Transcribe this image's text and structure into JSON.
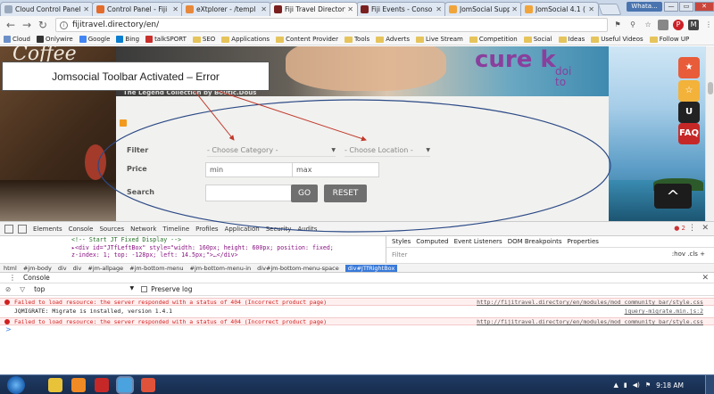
{
  "browser": {
    "tabs": [
      {
        "title": "Cloud Control Panel",
        "color": "#9aa8bb"
      },
      {
        "title": "Control Panel - Fiji",
        "color": "#e36b2c"
      },
      {
        "title": "eXtplorer - /templ",
        "color": "#e8883a"
      },
      {
        "title": "Fiji Travel Directory",
        "color": "#7a1f1f"
      },
      {
        "title": "Fiji Events - Conso",
        "color": "#7a1f1f"
      },
      {
        "title": "JomSocial Support",
        "color": "#f1a43a"
      },
      {
        "title": "JomSocial 4.1 (1/1",
        "color": "#f1a43a"
      }
    ],
    "user_badge": "Whata...",
    "window_buttons": {
      "minimize": "—",
      "maximize": "▭",
      "close": "✕"
    },
    "address": "fijitravel.directory/en/",
    "bookmarks": [
      {
        "label": "Cloud",
        "type": "site",
        "color": "#6b8fc9"
      },
      {
        "label": "Onlywire",
        "type": "site",
        "color": "#333333"
      },
      {
        "label": "Google",
        "type": "site",
        "color": "#4285f4"
      },
      {
        "label": "Bing",
        "type": "site",
        "color": "#0b7ecf"
      },
      {
        "label": "talkSPORT",
        "type": "site",
        "color": "#c9302c"
      },
      {
        "label": "SEO",
        "type": "folder"
      },
      {
        "label": "Applications",
        "type": "folder"
      },
      {
        "label": "Content Provider",
        "type": "folder"
      },
      {
        "label": "Tools",
        "type": "folder"
      },
      {
        "label": "Adverts",
        "type": "folder"
      },
      {
        "label": "Live Stream",
        "type": "folder"
      },
      {
        "label": "Competition",
        "type": "folder"
      },
      {
        "label": "Social",
        "type": "folder"
      },
      {
        "label": "Ideas",
        "type": "folder"
      },
      {
        "label": "Useful Videos",
        "type": "folder"
      },
      {
        "label": "Follow UP",
        "type": "folder"
      }
    ]
  },
  "page": {
    "left_decor_text": "Coffee",
    "brand_text": "cure k",
    "brand_sub": "doi",
    "brand_sub2": "to",
    "tagline": "The Legend Collection by Boutic.Dous",
    "filter": {
      "filter_label": "Filter",
      "category_placeholder": "- Choose Category -",
      "location_placeholder": "- Choose Location -",
      "price_label": "Price",
      "min_placeholder": "min",
      "max_placeholder": "max",
      "search_label": "Search",
      "go_button": "GO",
      "reset_button": "RESET"
    },
    "side_icons": [
      {
        "name": "ribbon-icon",
        "label": "★",
        "color": "#e85c3a"
      },
      {
        "name": "rating-icon",
        "label": "☆",
        "color": "#f3b23a"
      },
      {
        "name": "magnet-icon",
        "label": "U",
        "color": "#222222"
      },
      {
        "name": "faq-icon",
        "label": "FAQ",
        "color": "#c62828"
      }
    ],
    "up_arrow": "^"
  },
  "annotation": {
    "callout": "Jomsocial Toolbar Activated – Error",
    "arrow_color": "#c0392b",
    "ellipse_color": "#2c4a86"
  },
  "devtools": {
    "tabs": [
      "Elements",
      "Console",
      "Sources",
      "Network",
      "Timeline",
      "Profiles",
      "Application",
      "Security",
      "Audits"
    ],
    "error_count": "2",
    "elements_lines": [
      "<!-- Start JT Fixed Display -->",
      "▸<div id=\"JTfLeftBox\" style=\"width: 160px; height: 600px; position: fixed;",
      "z-index: 1; top: -128px; left: 14.5px;\">…</div>"
    ],
    "styles_tabs": [
      "Styles",
      "Computed",
      "Event Listeners",
      "DOM Breakpoints",
      "Properties"
    ],
    "filter_placeholder": "Filter",
    "hov_cls": ":hov  .cls  +",
    "breadcrumbs": [
      "html",
      "#jm-body",
      "div",
      "div",
      "#jm-allpage",
      "#jm-bottom-menu",
      "#jm-bottom-menu-in",
      "div#jm-bottom-menu-space",
      "div#JTfRightBox"
    ],
    "console_label": "Console",
    "context": "top",
    "preserve_log": "Preserve log",
    "logs": [
      {
        "type": "error",
        "message": "Failed to load resource: the server responded with a status of 404 (Incorrect product page)",
        "source": "http://fijitravel.directory/en/modules/mod_community_bar/style.css"
      },
      {
        "type": "info",
        "message": "JQMIGRATE: Migrate is installed, version 1.4.1",
        "source": "jquery-migrate.min.js:2"
      },
      {
        "type": "error",
        "message": "Failed to load resource: the server responded with a status of 404 (Incorrect product page)",
        "source": "http://fijitravel.directory/en/modules/mod_community_bar/style.css"
      }
    ],
    "prompt": ">"
  },
  "taskbar": {
    "apps": [
      {
        "name": "chrome-icon",
        "color": "#e8c33a"
      },
      {
        "name": "vlc-icon",
        "color": "#f08a24"
      },
      {
        "name": "app-red-icon",
        "color": "#c62828"
      },
      {
        "name": "chrome-active-icon",
        "color": "#4aa3df"
      },
      {
        "name": "app-orange-icon",
        "color": "#e0533a"
      }
    ],
    "time": "9:18 AM"
  }
}
